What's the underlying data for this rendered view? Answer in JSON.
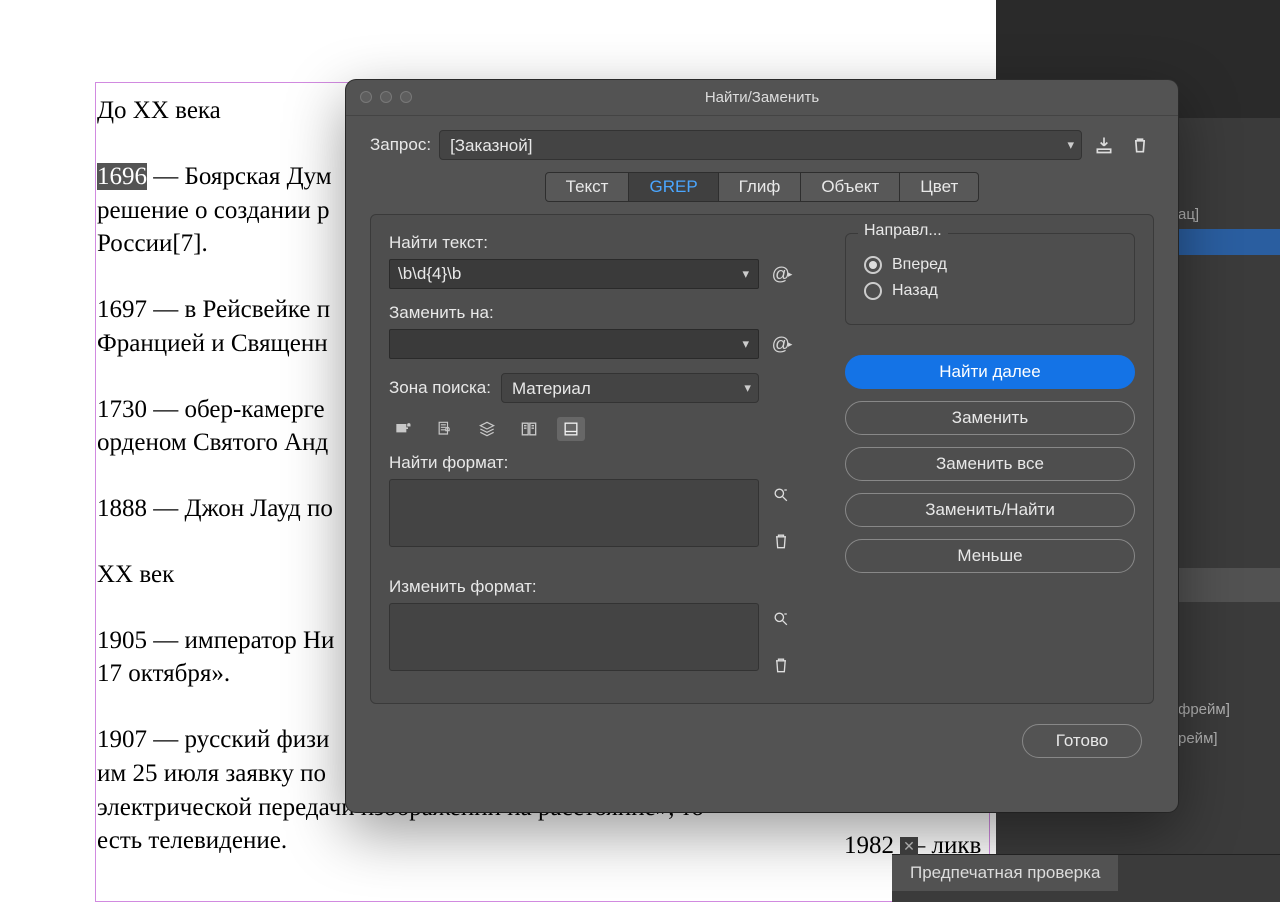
{
  "document": {
    "heading1": "До XX века",
    "highlight_year": "1696",
    "p1_rest": " — Боярская Дум",
    "p1b": "решение о создании р",
    "p1c": "России[7].",
    "p2a": "1697 — в Рейсвейке п",
    "p2b": "Францией и Священн",
    "p3a": "1730 — обер-камерге",
    "p3b": "орденом Святого Анд",
    "p4": "1888 — Джон Лауд по",
    "heading2": "XX век",
    "p5a": "1905 — император Ни",
    "p5b": "17 октября».",
    "p6a": "1907 — русский физи",
    "p6b": "им 25 июля заявку по",
    "p6c": "электрической передачи изображений на расстояние», то",
    "p6d": "есть телевидение.",
    "col2": "1982 — ликв"
  },
  "sidebar": {
    "item1": "ац]",
    "item2": "фрейм]",
    "item3": "рейм]"
  },
  "dialog": {
    "title": "Найти/Заменить",
    "query_label": "Запрос:",
    "query_value": "[Заказной]",
    "tabs": [
      "Текст",
      "GREP",
      "Глиф",
      "Объект",
      "Цвет"
    ],
    "active_tab": 1,
    "find_label": "Найти текст:",
    "find_value": "\\b\\d{4}\\b",
    "replace_label": "Заменить на:",
    "replace_value": "",
    "scope_label": "Зона поиска:",
    "scope_value": "Материал",
    "find_format_label": "Найти формат:",
    "change_format_label": "Изменить формат:",
    "direction": {
      "legend": "Направл...",
      "forward": "Вперед",
      "backward": "Назад",
      "selected": "forward"
    },
    "buttons": {
      "find_next": "Найти далее",
      "change": "Заменить",
      "change_all": "Заменить все",
      "change_find": "Заменить/Найти",
      "less": "Меньше",
      "done": "Готово"
    }
  },
  "preflight": {
    "title": "Предпечатная проверка"
  }
}
